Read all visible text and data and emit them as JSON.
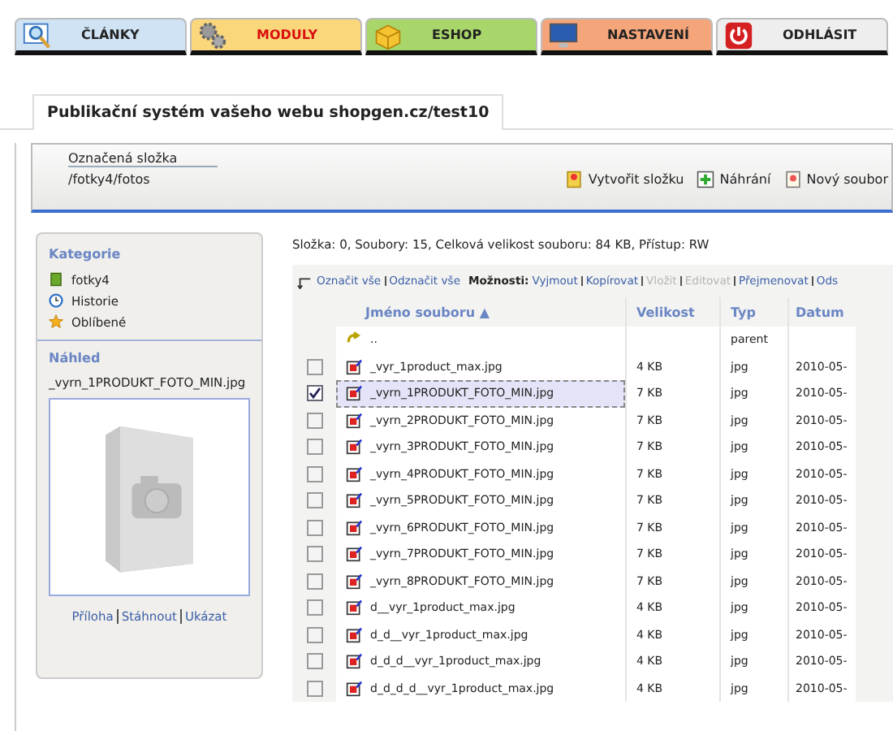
{
  "tabs": [
    {
      "label": "ČLÁNKY",
      "kind": "search",
      "color": "#cfe3f5",
      "selected": false
    },
    {
      "label": "MODULY",
      "kind": "gears",
      "color": "#fbd77c",
      "selected": true
    },
    {
      "label": "ESHOP",
      "kind": "box",
      "color": "#a9d66a",
      "selected": false
    },
    {
      "label": "NASTAVENÍ",
      "kind": "monitor",
      "color": "#f5a57a",
      "selected": false
    },
    {
      "label": "ODHLÁSIT",
      "kind": "power",
      "color": "#eeeeee",
      "selected": false
    }
  ],
  "page_title": "Publikační systém vašeho webu shopgen.cz/test10",
  "folder": {
    "label": "Označená složka",
    "path": "/fotky4/fotos"
  },
  "actions": [
    {
      "label": "Vytvořit složku",
      "kind": "folder"
    },
    {
      "label": "Náhrání",
      "kind": "upload"
    },
    {
      "label": "Nový soubor",
      "kind": "file"
    }
  ],
  "sidebar": {
    "categories_title": "Kategorie",
    "items": [
      {
        "label": "fotky4",
        "kind": "book"
      },
      {
        "label": "Historie",
        "kind": "clock"
      },
      {
        "label": "Oblíbené",
        "kind": "star"
      }
    ],
    "preview_title": "Náhled",
    "preview_file": "_vyrn_1PRODUKT_FOTO_MIN.jpg",
    "preview_links": [
      "Příloha",
      "Stáhnout",
      "Ukázat"
    ]
  },
  "summary": "Složka: 0, Soubory: 15, Celková velikost souboru: 84 KB, Přístup: RW",
  "select_links": [
    "Označit vše",
    "Odznačit vše"
  ],
  "options_label": "Možnosti:",
  "options": [
    {
      "label": "Vyjmout",
      "disabled": false
    },
    {
      "label": "Kopírovat",
      "disabled": false
    },
    {
      "label": "Vložit",
      "disabled": true
    },
    {
      "label": "Editovat",
      "disabled": true
    },
    {
      "label": "Přejmenovat",
      "disabled": false
    },
    {
      "label": "Ods",
      "disabled": false
    }
  ],
  "table": {
    "columns": [
      "Jméno souboru ▲",
      "Velikost",
      "Typ",
      "Datum"
    ],
    "rows": [
      {
        "kind": "parent",
        "name": "..",
        "size": "",
        "type": "parent",
        "date": ""
      },
      {
        "kind": "file",
        "name": "_vyr_1product_max.jpg",
        "size": "4 KB",
        "type": "jpg",
        "date": "2010-05-",
        "checked": false
      },
      {
        "kind": "file",
        "name": "_vyrn_1PRODUKT_FOTO_MIN.jpg",
        "size": "7 KB",
        "type": "jpg",
        "date": "2010-05-",
        "checked": true
      },
      {
        "kind": "file",
        "name": "_vyrn_2PRODUKT_FOTO_MIN.jpg",
        "size": "7 KB",
        "type": "jpg",
        "date": "2010-05-",
        "checked": false
      },
      {
        "kind": "file",
        "name": "_vyrn_3PRODUKT_FOTO_MIN.jpg",
        "size": "7 KB",
        "type": "jpg",
        "date": "2010-05-",
        "checked": false
      },
      {
        "kind": "file",
        "name": "_vyrn_4PRODUKT_FOTO_MIN.jpg",
        "size": "7 KB",
        "type": "jpg",
        "date": "2010-05-",
        "checked": false
      },
      {
        "kind": "file",
        "name": "_vyrn_5PRODUKT_FOTO_MIN.jpg",
        "size": "7 KB",
        "type": "jpg",
        "date": "2010-05-",
        "checked": false
      },
      {
        "kind": "file",
        "name": "_vyrn_6PRODUKT_FOTO_MIN.jpg",
        "size": "7 KB",
        "type": "jpg",
        "date": "2010-05-",
        "checked": false
      },
      {
        "kind": "file",
        "name": "_vyrn_7PRODUKT_FOTO_MIN.jpg",
        "size": "7 KB",
        "type": "jpg",
        "date": "2010-05-",
        "checked": false
      },
      {
        "kind": "file",
        "name": "_vyrn_8PRODUKT_FOTO_MIN.jpg",
        "size": "7 KB",
        "type": "jpg",
        "date": "2010-05-",
        "checked": false
      },
      {
        "kind": "file",
        "name": "d__vyr_1product_max.jpg",
        "size": "4 KB",
        "type": "jpg",
        "date": "2010-05-",
        "checked": false
      },
      {
        "kind": "file",
        "name": "d_d__vyr_1product_max.jpg",
        "size": "4 KB",
        "type": "jpg",
        "date": "2010-05-",
        "checked": false
      },
      {
        "kind": "file",
        "name": "d_d_d__vyr_1product_max.jpg",
        "size": "4 KB",
        "type": "jpg",
        "date": "2010-05-",
        "checked": false
      },
      {
        "kind": "file",
        "name": "d_d_d_d__vyr_1product_max.jpg",
        "size": "4 KB",
        "type": "jpg",
        "date": "2010-05-",
        "checked": false
      }
    ]
  }
}
